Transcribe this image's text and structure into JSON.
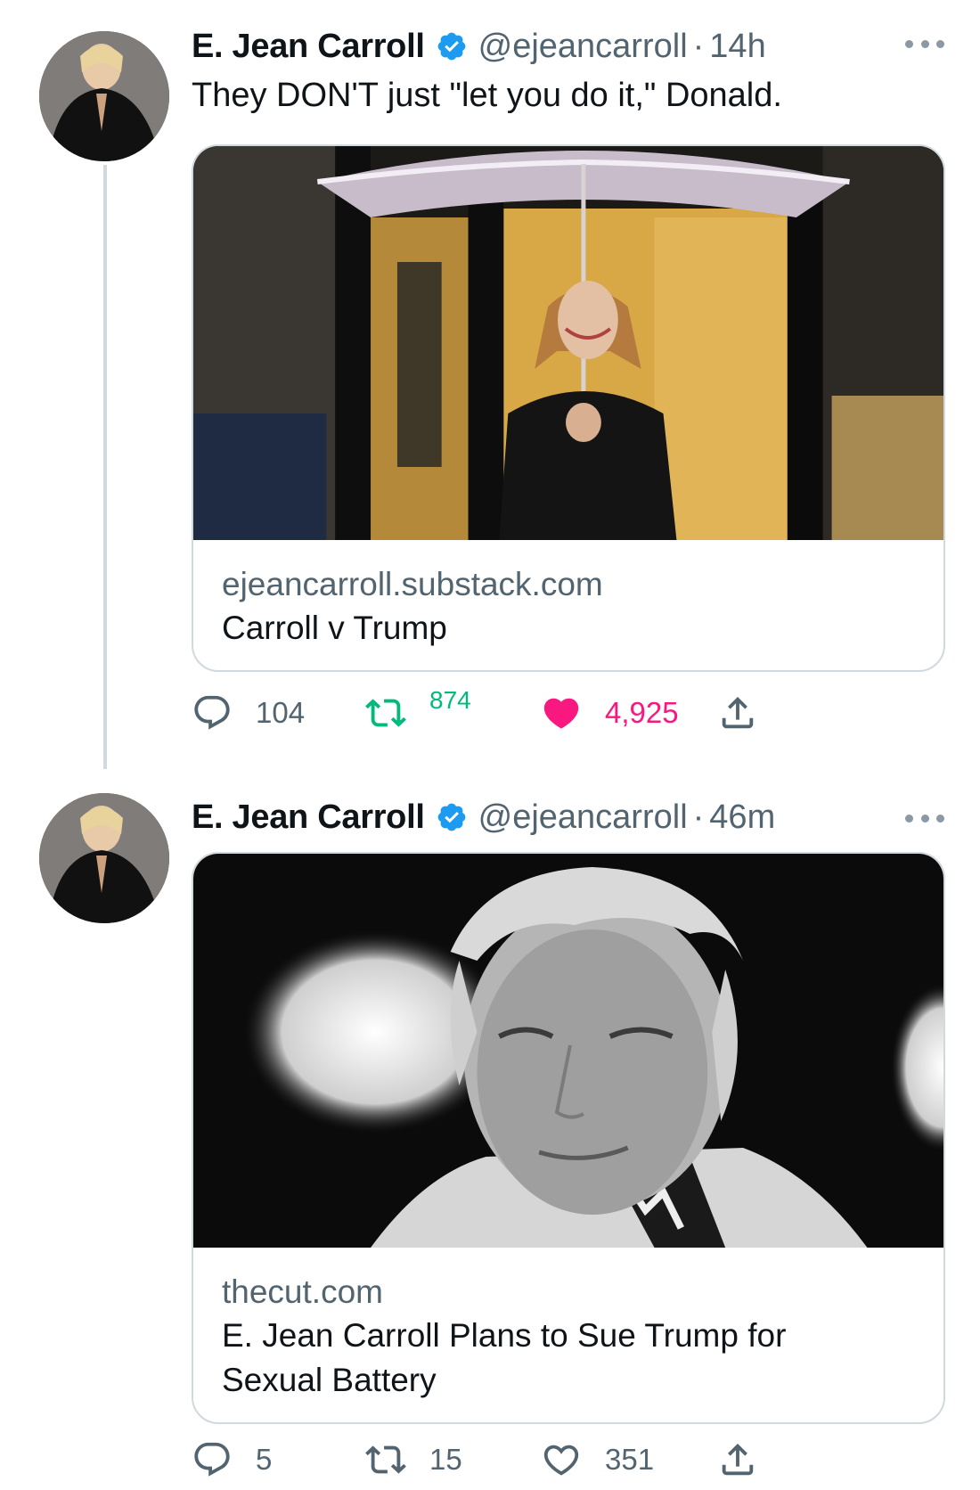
{
  "tweets": [
    {
      "author": {
        "name": "E. Jean Carroll",
        "handle": "@ejeancarroll",
        "separator": "·",
        "time": "14h",
        "verified": true
      },
      "text": "They DON'T just \"let you do it,\" Donald.",
      "card": {
        "domain": "ejeancarroll.substack.com",
        "title": "Carroll v Trump"
      },
      "actions": {
        "replies": "104",
        "retweets": "874",
        "likes": "4,925",
        "liked": true
      }
    },
    {
      "author": {
        "name": "E. Jean Carroll",
        "handle": "@ejeancarroll",
        "separator": "·",
        "time": "46m",
        "verified": true
      },
      "card": {
        "domain": "thecut.com",
        "title": "E. Jean Carroll Plans to Sue Trump for Sexual Battery"
      },
      "actions": {
        "replies": "5",
        "retweets": "15",
        "likes": "351",
        "liked": false
      }
    }
  ],
  "colors": {
    "verified": "#1d9bf0",
    "like": "#f91880",
    "retweet": "#00ba7c",
    "muted": "#536471",
    "border": "#cfd9de"
  },
  "icons": [
    "verified-badge-icon",
    "more-icon",
    "reply-icon",
    "retweet-icon",
    "like-icon",
    "share-icon"
  ]
}
